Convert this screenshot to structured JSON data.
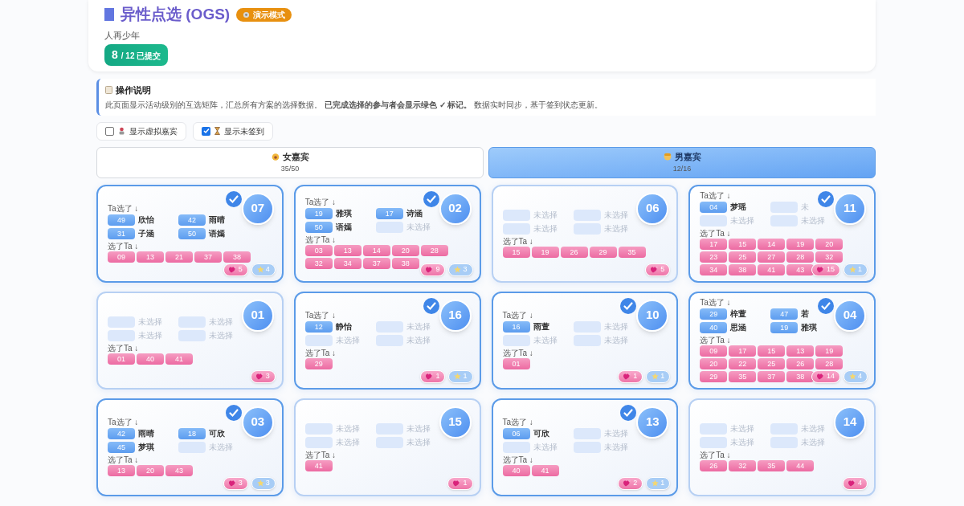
{
  "header": {
    "title": "异性点选 (OGS)",
    "mode_badge": "演示模式",
    "subtitle": "人再少年",
    "submitted": {
      "count": "8",
      "total": "/ 12 已提交"
    }
  },
  "instructions": {
    "title": "操作说明",
    "text": "此页面显示活动级别的互选矩阵，汇总所有方案的选择数据。 **已完成选择的参与者会显示绿色 ✓ 标记。** 数据实时同步，基于签到状态更新。"
  },
  "filters": [
    {
      "label": "显示虚拟嘉宾",
      "checked": false
    },
    {
      "label": "显示未签到",
      "checked": true
    }
  ],
  "tabs": [
    {
      "label": "女嘉宾",
      "count": "35/50",
      "selected": false
    },
    {
      "label": "男嘉宾",
      "count": "12/16",
      "selected": true
    }
  ],
  "cards": [
    {
      "number": "07",
      "done": true,
      "picked_label": "Ta选了 ↓",
      "picks": [
        {
          "kind": "pick",
          "num": "49",
          "name": "欣怡"
        },
        {
          "kind": "pick",
          "num": "42",
          "name": "雨晴"
        },
        {
          "kind": "pick",
          "num": "31",
          "name": "子涵"
        },
        {
          "kind": "pick",
          "num": "50",
          "name": "语嫣"
        }
      ],
      "chosen_label": "选了Ta ↓",
      "chosen": [
        "09",
        "13",
        "21",
        "37",
        "38"
      ],
      "heart_count": "5",
      "star_count": "4"
    },
    {
      "number": "02",
      "done": true,
      "picked_label": "Ta选了 ↓",
      "picks": [
        {
          "kind": "pick",
          "num": "19",
          "name": "雅琪"
        },
        {
          "kind": "pick",
          "num": "17",
          "name": "诗涵"
        },
        {
          "kind": "pick",
          "num": "50",
          "name": "语嫣"
        },
        {
          "kind": "empty",
          "name": "未选择"
        }
      ],
      "chosen_label": "选了Ta ↓",
      "chosen": [
        "03",
        "13",
        "14",
        "20",
        "28",
        "32",
        "34",
        "37",
        "38"
      ],
      "heart_count": "9",
      "star_count": "3"
    },
    {
      "number": "06",
      "done": false,
      "picks": [
        {
          "kind": "empty",
          "name": "未选择"
        },
        {
          "kind": "empty",
          "name": "未选择"
        },
        {
          "kind": "empty",
          "name": "未选择"
        },
        {
          "kind": "empty",
          "name": "未选择"
        }
      ],
      "chosen_label": "选了Ta ↓",
      "chosen": [
        "15",
        "19",
        "26",
        "29",
        "35"
      ],
      "heart_count": "5"
    },
    {
      "number": "11",
      "done": true,
      "picked_label": "Ta选了 ↓",
      "picks": [
        {
          "kind": "pick",
          "num": "04",
          "name": "梦瑶"
        },
        {
          "kind": "empty",
          "name": "未"
        },
        {
          "kind": "empty",
          "name": "未选择"
        },
        {
          "kind": "empty",
          "name": "未选择"
        }
      ],
      "chosen_label": "选了Ta ↓",
      "chosen": [
        "17",
        "15",
        "14",
        "19",
        "20",
        "23",
        "25",
        "27",
        "28",
        "32",
        "34",
        "38",
        "41",
        "43"
      ],
      "heart_count": "15",
      "star_count": "1"
    },
    {
      "number": "01",
      "done": false,
      "picks": [
        {
          "kind": "empty",
          "name": "未选择"
        },
        {
          "kind": "empty",
          "name": "未选择"
        },
        {
          "kind": "empty",
          "name": "未选择"
        },
        {
          "kind": "empty",
          "name": "未选择"
        }
      ],
      "chosen_label": "选了Ta ↓",
      "chosen": [
        "01",
        "40",
        "41"
      ],
      "heart_count": "3"
    },
    {
      "number": "16",
      "done": true,
      "picked_label": "Ta选了 ↓",
      "picks": [
        {
          "kind": "pick",
          "num": "12",
          "name": "静怡"
        },
        {
          "kind": "empty",
          "name": "未选择"
        },
        {
          "kind": "empty",
          "name": "未选择"
        },
        {
          "kind": "empty",
          "name": "未选择"
        }
      ],
      "chosen_label": "选了Ta ↓",
      "chosen": [
        "29"
      ],
      "heart_count": "1",
      "star_count": "1"
    },
    {
      "number": "10",
      "done": true,
      "picked_label": "Ta选了 ↓",
      "picks": [
        {
          "kind": "pick",
          "num": "16",
          "name": "雨萱"
        },
        {
          "kind": "empty",
          "name": "未选择"
        },
        {
          "kind": "empty",
          "name": "未选择"
        },
        {
          "kind": "empty",
          "name": "未选择"
        }
      ],
      "chosen_label": "选了Ta ↓",
      "chosen": [
        "01"
      ],
      "heart_count": "1",
      "star_count": "1"
    },
    {
      "number": "04",
      "done": true,
      "picked_label": "Ta选了 ↓",
      "picks": [
        {
          "kind": "pick",
          "num": "29",
          "name": "梓萱"
        },
        {
          "kind": "pick",
          "num": "47",
          "name": "若"
        },
        {
          "kind": "pick",
          "num": "40",
          "name": "思涵"
        },
        {
          "kind": "pick",
          "num": "19",
          "name": "雅琪"
        }
      ],
      "chosen_label": "选了Ta ↓",
      "chosen": [
        "09",
        "17",
        "15",
        "13",
        "19",
        "20",
        "22",
        "25",
        "26",
        "28",
        "29",
        "35",
        "37",
        "38"
      ],
      "heart_count": "14",
      "star_count": "4"
    },
    {
      "number": "03",
      "done": true,
      "picked_label": "Ta选了 ↓",
      "picks": [
        {
          "kind": "pick",
          "num": "42",
          "name": "雨晴"
        },
        {
          "kind": "pick",
          "num": "18",
          "name": "可欣"
        },
        {
          "kind": "pick",
          "num": "45",
          "name": "梦琪"
        },
        {
          "kind": "empty",
          "name": "未选择"
        }
      ],
      "chosen_label": "选了Ta ↓",
      "chosen": [
        "13",
        "20",
        "43"
      ],
      "heart_count": "3",
      "star_count": "3"
    },
    {
      "number": "15",
      "done": false,
      "picks": [
        {
          "kind": "empty",
          "name": "未选择"
        },
        {
          "kind": "empty",
          "name": "未选择"
        },
        {
          "kind": "empty",
          "name": "未选择"
        },
        {
          "kind": "empty",
          "name": "未选择"
        }
      ],
      "chosen_label": "选了Ta ↓",
      "chosen": [
        "41"
      ],
      "heart_count": "1"
    },
    {
      "number": "13",
      "done": true,
      "picked_label": "Ta选了 ↓",
      "picks": [
        {
          "kind": "pick",
          "num": "06",
          "name": "可欣"
        },
        {
          "kind": "empty",
          "name": "未选择"
        },
        {
          "kind": "empty",
          "name": "未选择"
        },
        {
          "kind": "empty",
          "name": "未选择"
        }
      ],
      "chosen_label": "选了Ta ↓",
      "chosen": [
        "40",
        "41"
      ],
      "heart_count": "2",
      "star_count": "1"
    },
    {
      "number": "14",
      "done": false,
      "picks": [
        {
          "kind": "empty",
          "name": "未选择"
        },
        {
          "kind": "empty",
          "name": "未选择"
        },
        {
          "kind": "empty",
          "name": "未选择"
        },
        {
          "kind": "empty",
          "name": "未选择"
        }
      ],
      "chosen_label": "选了Ta ↓",
      "chosen": [
        "26",
        "32",
        "35",
        "44"
      ],
      "heart_count": "4"
    }
  ]
}
